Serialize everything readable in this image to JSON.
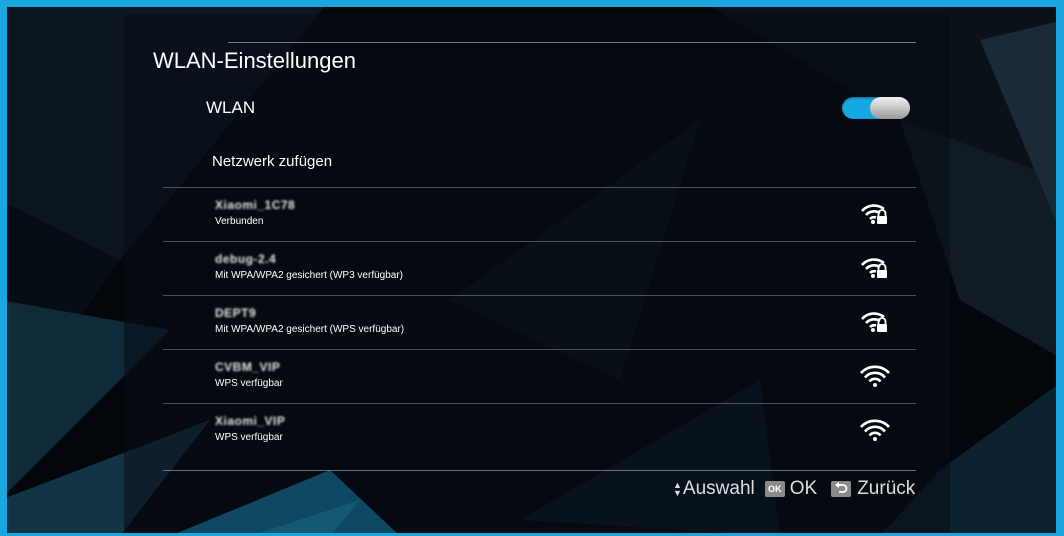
{
  "header": {
    "title": "WLAN-Einstellungen"
  },
  "wlan": {
    "label": "WLAN",
    "enabled": true
  },
  "add_network": {
    "label": "Netzwerk zufügen"
  },
  "networks": [
    {
      "ssid": "Xiaomi_1C78",
      "status": "Verbunden",
      "secured": true
    },
    {
      "ssid": "debug-2.4",
      "status": "Mit WPA/WPA2 gesichert (WP3 verfügbar)",
      "secured": true
    },
    {
      "ssid": "DEPT9",
      "status": "Mit WPA/WPA2 gesichert (WPS verfügbar)",
      "secured": true
    },
    {
      "ssid": "CVBM_VIP",
      "status": "WPS verfügbar",
      "secured": false
    },
    {
      "ssid": "Xiaomi_VIP",
      "status": "WPS verfügbar",
      "secured": false
    }
  ],
  "footer": {
    "select_label": "Auswahl",
    "ok_key": "OK",
    "ok_label": "OK",
    "back_label": "Zurück"
  },
  "colors": {
    "accent": "#14a9e2",
    "frame": "#1aa7e0"
  }
}
